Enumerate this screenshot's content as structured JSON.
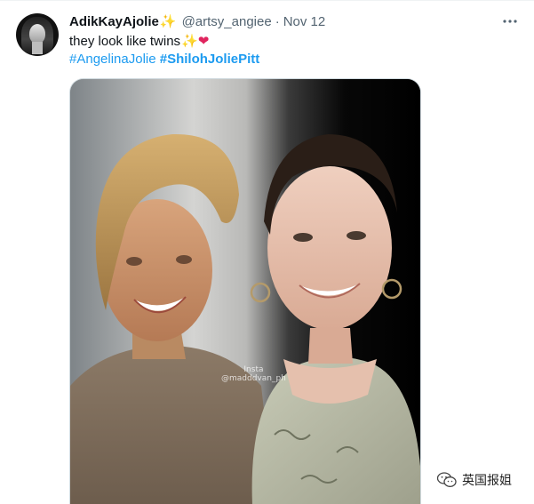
{
  "tweet": {
    "display_name": "AdikKayAjolie",
    "name_emoji": "✨",
    "handle": "@artsy_angiee",
    "separator": "·",
    "date": "Nov 12",
    "more_icon": "more-horizontal-icon",
    "text": "they look like twins",
    "text_emoji_1": "✨",
    "text_emoji_2": "❤",
    "hashtags": [
      "#AngelinaJolie",
      "#ShilohJoliePitt"
    ]
  },
  "media": {
    "watermark_line1": "Insta",
    "watermark_line2": "@madddvan_ph"
  },
  "overlay": {
    "wechat_label": "英国报姐"
  },
  "colors": {
    "link": "#1d9bf0",
    "secondary_text": "#536471",
    "primary_text": "#0f1419",
    "heart": "#e0245e",
    "sparkle": "#f4c20d"
  }
}
